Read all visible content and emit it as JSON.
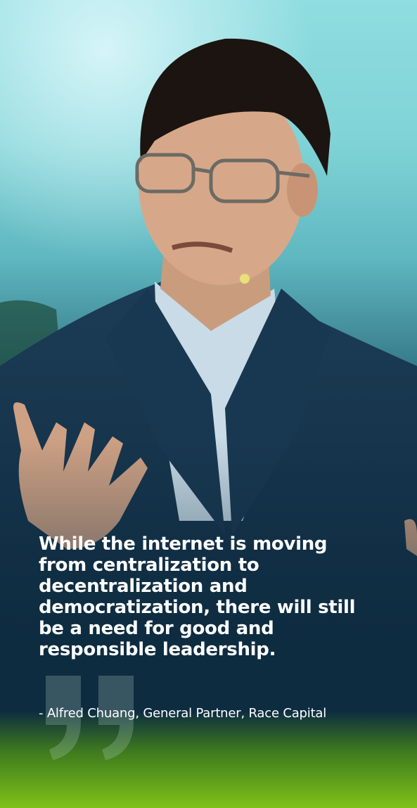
{
  "quote": {
    "text": "While the internet is moving from centralization to decentralization and democratization, there will still be a need for good and responsible leadership.",
    "attribution": "- Alfred Chuang, General Partner, Race Capital"
  },
  "colors": {
    "sky": "#8fdde0",
    "navy": "#0f2f47",
    "green": "#7fc21a",
    "text": "#ffffff"
  },
  "icons": [
    "quote-mark-icon"
  ]
}
